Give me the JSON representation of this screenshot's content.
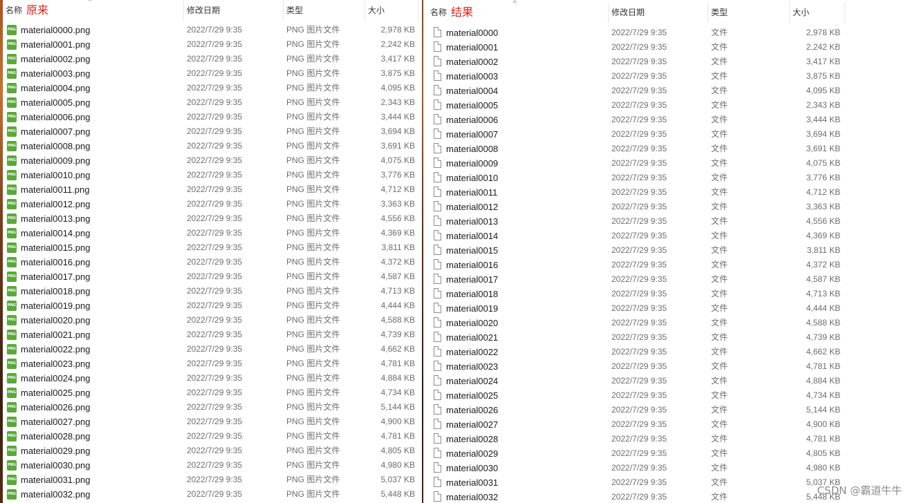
{
  "columns": {
    "name": "名称",
    "date": "修改日期",
    "type": "类型",
    "size": "大小"
  },
  "left": {
    "caption": "原来",
    "type_label": "PNG 图片文件",
    "rows": [
      {
        "name": "material0000.png",
        "date": "2022/7/29 9:35",
        "size": "2,978 KB"
      },
      {
        "name": "material0001.png",
        "date": "2022/7/29 9:35",
        "size": "2,242 KB"
      },
      {
        "name": "material0002.png",
        "date": "2022/7/29 9:35",
        "size": "3,417 KB"
      },
      {
        "name": "material0003.png",
        "date": "2022/7/29 9:35",
        "size": "3,875 KB"
      },
      {
        "name": "material0004.png",
        "date": "2022/7/29 9:35",
        "size": "4,095 KB"
      },
      {
        "name": "material0005.png",
        "date": "2022/7/29 9:35",
        "size": "2,343 KB"
      },
      {
        "name": "material0006.png",
        "date": "2022/7/29 9:35",
        "size": "3,444 KB"
      },
      {
        "name": "material0007.png",
        "date": "2022/7/29 9:35",
        "size": "3,694 KB"
      },
      {
        "name": "material0008.png",
        "date": "2022/7/29 9:35",
        "size": "3,691 KB"
      },
      {
        "name": "material0009.png",
        "date": "2022/7/29 9:35",
        "size": "4,075 KB"
      },
      {
        "name": "material0010.png",
        "date": "2022/7/29 9:35",
        "size": "3,776 KB"
      },
      {
        "name": "material0011.png",
        "date": "2022/7/29 9:35",
        "size": "4,712 KB"
      },
      {
        "name": "material0012.png",
        "date": "2022/7/29 9:35",
        "size": "3,363 KB"
      },
      {
        "name": "material0013.png",
        "date": "2022/7/29 9:35",
        "size": "4,556 KB"
      },
      {
        "name": "material0014.png",
        "date": "2022/7/29 9:35",
        "size": "4,369 KB"
      },
      {
        "name": "material0015.png",
        "date": "2022/7/29 9:35",
        "size": "3,811 KB"
      },
      {
        "name": "material0016.png",
        "date": "2022/7/29 9:35",
        "size": "4,372 KB"
      },
      {
        "name": "material0017.png",
        "date": "2022/7/29 9:35",
        "size": "4,587 KB"
      },
      {
        "name": "material0018.png",
        "date": "2022/7/29 9:35",
        "size": "4,713 KB"
      },
      {
        "name": "material0019.png",
        "date": "2022/7/29 9:35",
        "size": "4,444 KB"
      },
      {
        "name": "material0020.png",
        "date": "2022/7/29 9:35",
        "size": "4,588 KB"
      },
      {
        "name": "material0021.png",
        "date": "2022/7/29 9:35",
        "size": "4,739 KB"
      },
      {
        "name": "material0022.png",
        "date": "2022/7/29 9:35",
        "size": "4,662 KB"
      },
      {
        "name": "material0023.png",
        "date": "2022/7/29 9:35",
        "size": "4,781 KB"
      },
      {
        "name": "material0024.png",
        "date": "2022/7/29 9:35",
        "size": "4,884 KB"
      },
      {
        "name": "material0025.png",
        "date": "2022/7/29 9:35",
        "size": "4,734 KB"
      },
      {
        "name": "material0026.png",
        "date": "2022/7/29 9:35",
        "size": "5,144 KB"
      },
      {
        "name": "material0027.png",
        "date": "2022/7/29 9:35",
        "size": "4,900 KB"
      },
      {
        "name": "material0028.png",
        "date": "2022/7/29 9:35",
        "size": "4,781 KB"
      },
      {
        "name": "material0029.png",
        "date": "2022/7/29 9:35",
        "size": "4,805 KB"
      },
      {
        "name": "material0030.png",
        "date": "2022/7/29 9:35",
        "size": "4,980 KB"
      },
      {
        "name": "material0031.png",
        "date": "2022/7/29 9:35",
        "size": "5,037 KB"
      },
      {
        "name": "material0032.png",
        "date": "2022/7/29 9:35",
        "size": "5,448 KB"
      }
    ]
  },
  "right": {
    "caption": "结果",
    "type_label": "文件",
    "rows": [
      {
        "name": "material0000",
        "date": "2022/7/29 9:35",
        "size": "2,978 KB"
      },
      {
        "name": "material0001",
        "date": "2022/7/29 9:35",
        "size": "2,242 KB"
      },
      {
        "name": "material0002",
        "date": "2022/7/29 9:35",
        "size": "3,417 KB"
      },
      {
        "name": "material0003",
        "date": "2022/7/29 9:35",
        "size": "3,875 KB"
      },
      {
        "name": "material0004",
        "date": "2022/7/29 9:35",
        "size": "4,095 KB"
      },
      {
        "name": "material0005",
        "date": "2022/7/29 9:35",
        "size": "2,343 KB"
      },
      {
        "name": "material0006",
        "date": "2022/7/29 9:35",
        "size": "3,444 KB"
      },
      {
        "name": "material0007",
        "date": "2022/7/29 9:35",
        "size": "3,694 KB"
      },
      {
        "name": "material0008",
        "date": "2022/7/29 9:35",
        "size": "3,691 KB"
      },
      {
        "name": "material0009",
        "date": "2022/7/29 9:35",
        "size": "4,075 KB"
      },
      {
        "name": "material0010",
        "date": "2022/7/29 9:35",
        "size": "3,776 KB"
      },
      {
        "name": "material0011",
        "date": "2022/7/29 9:35",
        "size": "4,712 KB"
      },
      {
        "name": "material0012",
        "date": "2022/7/29 9:35",
        "size": "3,363 KB"
      },
      {
        "name": "material0013",
        "date": "2022/7/29 9:35",
        "size": "4,556 KB"
      },
      {
        "name": "material0014",
        "date": "2022/7/29 9:35",
        "size": "4,369 KB"
      },
      {
        "name": "material0015",
        "date": "2022/7/29 9:35",
        "size": "3,811 KB"
      },
      {
        "name": "material0016",
        "date": "2022/7/29 9:35",
        "size": "4,372 KB"
      },
      {
        "name": "material0017",
        "date": "2022/7/29 9:35",
        "size": "4,587 KB"
      },
      {
        "name": "material0018",
        "date": "2022/7/29 9:35",
        "size": "4,713 KB"
      },
      {
        "name": "material0019",
        "date": "2022/7/29 9:35",
        "size": "4,444 KB"
      },
      {
        "name": "material0020",
        "date": "2022/7/29 9:35",
        "size": "4,588 KB"
      },
      {
        "name": "material0021",
        "date": "2022/7/29 9:35",
        "size": "4,739 KB"
      },
      {
        "name": "material0022",
        "date": "2022/7/29 9:35",
        "size": "4,662 KB"
      },
      {
        "name": "material0023",
        "date": "2022/7/29 9:35",
        "size": "4,781 KB"
      },
      {
        "name": "material0024",
        "date": "2022/7/29 9:35",
        "size": "4,884 KB"
      },
      {
        "name": "material0025",
        "date": "2022/7/29 9:35",
        "size": "4,734 KB"
      },
      {
        "name": "material0026",
        "date": "2022/7/29 9:35",
        "size": "5,144 KB"
      },
      {
        "name": "material0027",
        "date": "2022/7/29 9:35",
        "size": "4,900 KB"
      },
      {
        "name": "material0028",
        "date": "2022/7/29 9:35",
        "size": "4,781 KB"
      },
      {
        "name": "material0029",
        "date": "2022/7/29 9:35",
        "size": "4,805 KB"
      },
      {
        "name": "material0030",
        "date": "2022/7/29 9:35",
        "size": "4,980 KB"
      },
      {
        "name": "material0031",
        "date": "2022/7/29 9:35",
        "size": "5,037 KB"
      },
      {
        "name": "material0032",
        "date": "2022/7/29 9:35",
        "size": "5,448 KB"
      }
    ]
  },
  "png_icon_text": "PNG",
  "watermark": "CSDN @霸道牛牛",
  "icons": {
    "png": "png-file-icon",
    "file": "blank-file-icon",
    "sort": "sort-up-caret-icon"
  }
}
